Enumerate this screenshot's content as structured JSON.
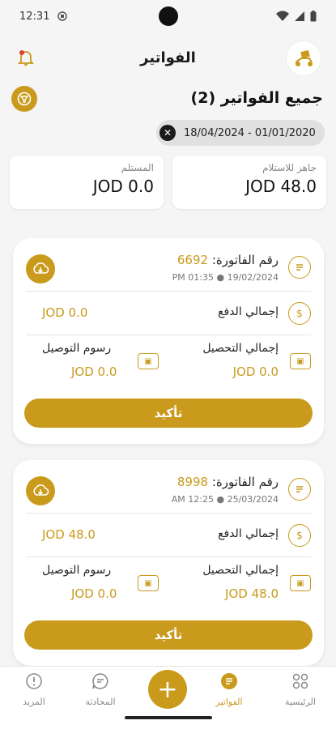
{
  "status": {
    "time": "12:31"
  },
  "header": {
    "title": "الفواتير"
  },
  "section": {
    "title": "جميع الفواتير (2)"
  },
  "filter_chip": {
    "label": "18/04/2024 - 01/01/2020"
  },
  "stats": [
    {
      "label": "جاهز للاستلام",
      "value": "JOD 48.0"
    },
    {
      "label": "المستلم",
      "value": "JOD 0.0"
    }
  ],
  "labels": {
    "invoice_no": "رقم الفاتورة:",
    "total_payment": "إجمالي الدفع",
    "total_collection": "إجمالي التحصيل",
    "delivery_fees": "رسوم التوصيل",
    "confirm": "تأكيد"
  },
  "invoices": [
    {
      "number": "6692",
      "date": "19/02/2024",
      "time": "PM 01:35",
      "total_payment": "JOD 0.0",
      "total_collection": "JOD 0.0",
      "delivery_fees": "JOD 0.0"
    },
    {
      "number": "8998",
      "date": "25/03/2024",
      "time": "AM 12:25",
      "total_payment": "JOD 48.0",
      "total_collection": "JOD 48.0",
      "delivery_fees": "JOD 0.0"
    }
  ],
  "nav": [
    {
      "label": "الرئيسية",
      "icon": "grid-icon"
    },
    {
      "label": "الفواتير",
      "icon": "invoice-icon",
      "active": true
    },
    {
      "label": "المحادثة",
      "icon": "chat-icon"
    },
    {
      "label": "المزيد",
      "icon": "more-icon"
    }
  ],
  "colors": {
    "accent": "#c99a1c",
    "background": "#f5f5f5"
  }
}
